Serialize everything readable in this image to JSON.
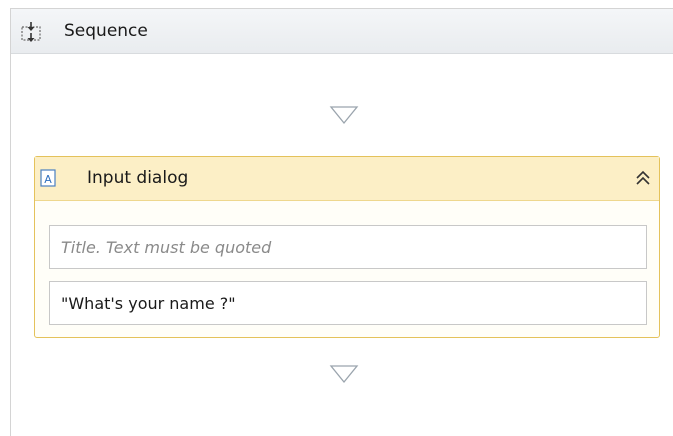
{
  "sequence": {
    "title": "Sequence",
    "icon": "sequence-icon"
  },
  "input_dialog": {
    "title": "Input dialog",
    "icon": "input-dialog-icon",
    "collapse_icon": "double-chevron-up-icon",
    "title_field": {
      "placeholder": "Title. Text must be quoted",
      "value": ""
    },
    "label_field": {
      "value": "\"What's your name ?\""
    }
  },
  "colors": {
    "activity_header": "#fcefc6",
    "activity_border": "#e4c25b",
    "sequence_header": "#eceff2"
  }
}
